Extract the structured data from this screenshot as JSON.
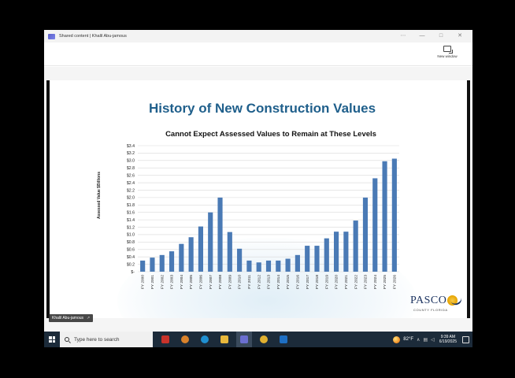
{
  "window": {
    "title": "Shared content | Khalil Abu-jamous",
    "controls": [
      "⋯",
      "—",
      "□",
      "✕"
    ],
    "new_window_label": "New window"
  },
  "slide": {
    "title": "History of New Construction Values",
    "presenter": "Khalil Abu-jamous",
    "logo_text": "PASCO",
    "logo_sub": "COUNTY FLORIDA"
  },
  "chart_data": {
    "type": "bar",
    "title": "Cannot Expect Assessed Values to Remain at These Levels",
    "ylabel": "Assessed Value $Billions",
    "ylim": [
      0,
      3.4
    ],
    "ytick_labels": [
      "$-",
      "$0.2",
      "$0.4",
      "$0.6",
      "$0.8",
      "$1.0",
      "$1.2",
      "$1.4",
      "$1.6",
      "$1.8",
      "$2.0",
      "$2.2",
      "$2.4",
      "$2.6",
      "$2.8",
      "$3.0",
      "$3.2",
      "$3.4"
    ],
    "categories": [
      "FY 2000",
      "FY 2001",
      "FY 2002",
      "FY 2003",
      "FY 2004",
      "FY 2005",
      "FY 2006",
      "FY 2007",
      "FY 2008",
      "FY 2009",
      "FY 2010",
      "FY 2011",
      "FY 2012",
      "FY 2013",
      "FY 2014",
      "FY 2015",
      "FY 2016",
      "FY 2017",
      "FY 2018",
      "FY 2019",
      "FY 2020",
      "FY 2021",
      "FY 2022",
      "FY 2023",
      "FY 2024",
      "FY 2025",
      "FY 2026"
    ],
    "values": [
      0.3,
      0.38,
      0.45,
      0.55,
      0.75,
      0.93,
      1.22,
      1.6,
      2.0,
      1.07,
      0.62,
      0.3,
      0.25,
      0.3,
      0.3,
      0.35,
      0.45,
      0.7,
      0.7,
      0.9,
      1.08,
      1.08,
      1.38,
      2.0,
      2.52,
      2.98,
      3.05
    ],
    "grid": true,
    "legend": "none",
    "color": "#4a7ab5"
  },
  "taskbar": {
    "search_placeholder": "Type here to search",
    "weather_temp": "82°F",
    "time": "9:39 AM",
    "date": "6/19/2025",
    "apps": [
      {
        "icon": "start-app-icon",
        "color": "#c8332b"
      },
      {
        "icon": "browser-icon",
        "color": "#d9822b"
      },
      {
        "icon": "edge-icon",
        "color": "#1f8fd1"
      },
      {
        "icon": "file-explorer-icon",
        "color": "#e8b83c"
      },
      {
        "icon": "teams-icon",
        "color": "#6b6fd0"
      },
      {
        "icon": "chrome-icon",
        "color": "#e0b030"
      },
      {
        "icon": "outlook-icon",
        "color": "#1e6fc4"
      }
    ]
  }
}
